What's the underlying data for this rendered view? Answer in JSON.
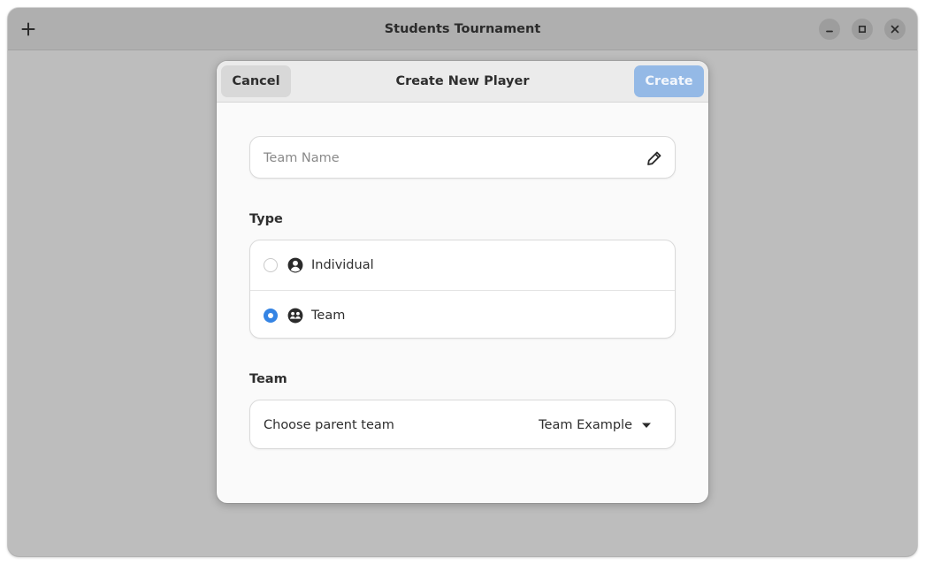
{
  "window": {
    "title": "Students Tournament",
    "buttons": {
      "add_icon": "plus-icon",
      "minimize_icon": "minimize-icon",
      "maximize_icon": "maximize-icon",
      "close_icon": "close-icon"
    }
  },
  "dialog": {
    "title": "Create New Player",
    "cancel_label": "Cancel",
    "create_label": "Create",
    "name_field": {
      "placeholder": "Team Name",
      "icon": "edit-icon"
    },
    "type_section": {
      "label": "Type",
      "options": [
        {
          "label": "Individual",
          "icon": "person-icon",
          "selected": false
        },
        {
          "label": "Team",
          "icon": "team-icon",
          "selected": true
        }
      ]
    },
    "team_section": {
      "label": "Team",
      "combo_label": "Choose parent team",
      "combo_value": "Team Example",
      "combo_icon": "dropdown-arrow-icon"
    }
  },
  "colors": {
    "accent": "#3584e4",
    "create_disabled": "#94b9e6",
    "window_bg": "#bdbdbd",
    "titlebar_bg": "#afafaf"
  }
}
